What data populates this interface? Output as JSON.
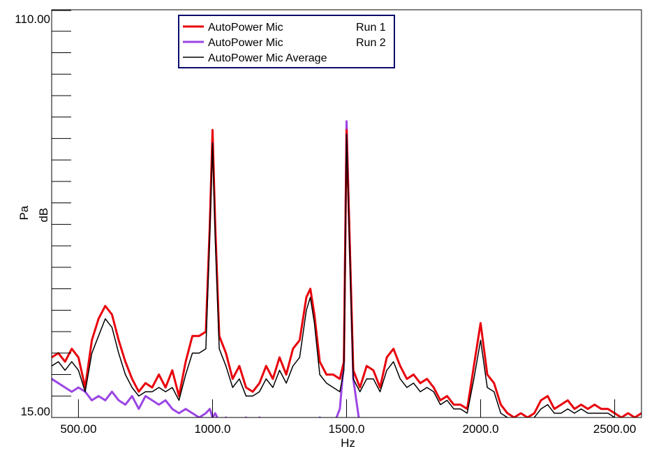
{
  "chart_data": {
    "type": "line",
    "xlabel": "Hz",
    "ylabel_lines": [
      "Pa",
      "dB"
    ],
    "xlim": [
      400,
      2600
    ],
    "ylim": [
      15,
      110
    ],
    "x_ticks": [
      {
        "value": 500,
        "label": "500.00"
      },
      {
        "value": 1000,
        "label": "1000.0"
      },
      {
        "value": 1500,
        "label": "1500.0"
      },
      {
        "value": 2000,
        "label": "2000.0"
      },
      {
        "value": 2500,
        "label": "2500.00"
      }
    ],
    "y_ticks": [
      {
        "value": 110,
        "label": "110.00"
      },
      {
        "value": 15,
        "label": "15.00"
      }
    ],
    "y_minor_ticks": [
      105,
      100,
      95,
      90,
      85,
      80,
      75,
      70,
      65,
      60,
      55,
      50,
      45,
      40,
      35,
      30,
      25,
      20
    ],
    "grid": false,
    "legend_position": "top-center",
    "series": [
      {
        "name": "AutoPower Mic",
        "run": "Run 1",
        "color": "#e8000b",
        "x": [
          400,
          425,
          450,
          475,
          500,
          525,
          550,
          575,
          600,
          625,
          650,
          675,
          700,
          725,
          750,
          775,
          800,
          825,
          850,
          875,
          900,
          925,
          950,
          975,
          990,
          1000,
          1010,
          1025,
          1050,
          1075,
          1100,
          1125,
          1150,
          1175,
          1200,
          1225,
          1250,
          1275,
          1300,
          1325,
          1350,
          1365,
          1380,
          1400,
          1425,
          1450,
          1475,
          1490,
          1500,
          1510,
          1525,
          1550,
          1575,
          1600,
          1625,
          1650,
          1675,
          1700,
          1725,
          1750,
          1775,
          1800,
          1825,
          1850,
          1875,
          1900,
          1925,
          1950,
          1975,
          2000,
          2025,
          2050,
          2075,
          2100,
          2125,
          2150,
          2175,
          2200,
          2225,
          2250,
          2275,
          2300,
          2325,
          2350,
          2375,
          2400,
          2425,
          2450,
          2475,
          2500,
          2525,
          2550,
          2575,
          2600
        ],
        "y": [
          29,
          30,
          28,
          31,
          29,
          22,
          33,
          38,
          41,
          39,
          33,
          28,
          24,
          21,
          23,
          22,
          25,
          22,
          26,
          20,
          28,
          34,
          34,
          35,
          60,
          82,
          60,
          34,
          30,
          24,
          27,
          22,
          21,
          23,
          27,
          24,
          29,
          25,
          31,
          33,
          43,
          45,
          39,
          28,
          25,
          25,
          24,
          28,
          82,
          60,
          26,
          22,
          27,
          26,
          22,
          29,
          31,
          27,
          24,
          25,
          23,
          24,
          22,
          19,
          20,
          18,
          18,
          17,
          27,
          37,
          25,
          23,
          18,
          16,
          15,
          16,
          15,
          16,
          19,
          20,
          17,
          18,
          19,
          17,
          18,
          17,
          18,
          17,
          17,
          16,
          15,
          16,
          15,
          16
        ]
      },
      {
        "name": "AutoPower Mic",
        "run": "Run 2",
        "color": "#9b45e4",
        "x": [
          400,
          425,
          450,
          475,
          500,
          525,
          550,
          575,
          600,
          625,
          650,
          675,
          700,
          725,
          750,
          775,
          800,
          825,
          850,
          875,
          900,
          925,
          950,
          975,
          990,
          1000,
          1010,
          1025,
          1050,
          1075,
          1100,
          1125,
          1150,
          1175,
          1200,
          1225,
          1250,
          1275,
          1300,
          1325,
          1350,
          1365,
          1380,
          1400,
          1425,
          1450,
          1475,
          1490,
          1500,
          1510,
          1525,
          1550,
          1575,
          1600,
          1625,
          1650,
          1675,
          1700,
          1725,
          1750,
          1775,
          1800,
          1825,
          1850,
          1875,
          1900,
          1925,
          1950,
          1975,
          2000,
          2025,
          2050,
          2075,
          2100,
          2125,
          2150,
          2175,
          2200,
          2225,
          2250,
          2275,
          2300,
          2325,
          2350,
          2375,
          2400,
          2425,
          2450,
          2475,
          2500,
          2525,
          2550,
          2575,
          2600
        ],
        "y": [
          24,
          23,
          22,
          21,
          22,
          21,
          19,
          20,
          19,
          21,
          19,
          18,
          20,
          17,
          20,
          19,
          18,
          19,
          17,
          16,
          17,
          16,
          15,
          16,
          17,
          15,
          16,
          14,
          15,
          13,
          14,
          15,
          13,
          15,
          14,
          13,
          14,
          13,
          12,
          13,
          12,
          13,
          14,
          15,
          14,
          13,
          17,
          28,
          84,
          60,
          24,
          13,
          12,
          11,
          12,
          13,
          12,
          11,
          12,
          11,
          12,
          13,
          11,
          12,
          11,
          12,
          11,
          10,
          11,
          12,
          11,
          12,
          10,
          11,
          10,
          11,
          12,
          10,
          11,
          10,
          11,
          12,
          11,
          10,
          11,
          10,
          11,
          10,
          11,
          10,
          11,
          10,
          11,
          10
        ]
      },
      {
        "name": "AutoPower Mic Average",
        "run": "",
        "color": "#000000",
        "x": [
          400,
          425,
          450,
          475,
          500,
          525,
          550,
          575,
          600,
          625,
          650,
          675,
          700,
          725,
          750,
          775,
          800,
          825,
          850,
          875,
          900,
          925,
          950,
          975,
          990,
          1000,
          1010,
          1025,
          1050,
          1075,
          1100,
          1125,
          1150,
          1175,
          1200,
          1225,
          1250,
          1275,
          1300,
          1325,
          1350,
          1365,
          1380,
          1400,
          1425,
          1450,
          1475,
          1490,
          1500,
          1510,
          1525,
          1550,
          1575,
          1600,
          1625,
          1650,
          1675,
          1700,
          1725,
          1750,
          1775,
          1800,
          1825,
          1850,
          1875,
          1900,
          1925,
          1950,
          1975,
          2000,
          2025,
          2050,
          2075,
          2100,
          2125,
          2150,
          2175,
          2200,
          2225,
          2250,
          2275,
          2300,
          2325,
          2350,
          2375,
          2400,
          2425,
          2450,
          2475,
          2500,
          2525,
          2550,
          2575,
          2600
        ],
        "y": [
          27,
          28,
          26,
          28,
          26,
          21,
          30,
          34,
          38,
          36,
          30,
          25,
          22,
          20,
          21,
          21,
          22,
          21,
          22,
          19,
          25,
          30,
          30,
          31,
          58,
          79,
          57,
          31,
          27,
          22,
          24,
          20,
          20,
          21,
          24,
          22,
          26,
          23,
          27,
          29,
          40,
          43,
          37,
          25,
          23,
          22,
          21,
          26,
          81,
          58,
          24,
          21,
          24,
          24,
          21,
          26,
          28,
          24,
          22,
          23,
          21,
          22,
          21,
          18,
          19,
          17,
          17,
          16,
          24,
          33,
          22,
          21,
          16,
          15,
          14,
          15,
          14,
          15,
          17,
          18,
          16,
          16,
          17,
          16,
          17,
          16,
          16,
          16,
          16,
          15,
          14,
          15,
          14,
          15
        ]
      }
    ]
  }
}
